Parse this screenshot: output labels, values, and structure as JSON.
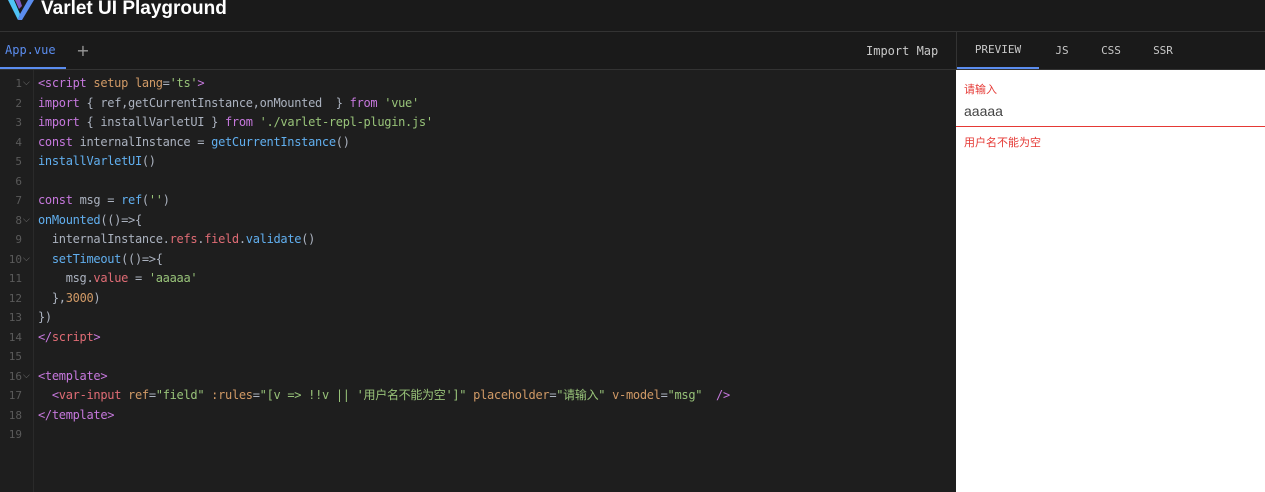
{
  "header": {
    "title": "Varlet UI Playground"
  },
  "editor_tabs": {
    "file": "App.vue",
    "add": "+",
    "import_map": "Import Map"
  },
  "output_tabs": [
    {
      "label": "PREVIEW",
      "active": true
    },
    {
      "label": "JS",
      "active": false
    },
    {
      "label": "CSS",
      "active": false
    },
    {
      "label": "SSR",
      "active": false
    }
  ],
  "line_numbers": [
    "1",
    "2",
    "3",
    "4",
    "5",
    "6",
    "7",
    "8",
    "9",
    "10",
    "11",
    "12",
    "13",
    "14",
    "15",
    "16",
    "17",
    "18",
    "19"
  ],
  "fold_lines": [
    1,
    8,
    10,
    16
  ],
  "code_lines": [
    [
      [
        "tag",
        "<script "
      ],
      [
        "attr",
        "setup "
      ],
      [
        "attr",
        "lang"
      ],
      [
        "punc",
        "="
      ],
      [
        "str",
        "'ts'"
      ],
      [
        "tag",
        ">"
      ]
    ],
    [
      [
        "kw",
        "import "
      ],
      [
        "punc",
        "{ "
      ],
      [
        "plain",
        "ref,getCurrentInstance,onMounted  "
      ],
      [
        "punc",
        "} "
      ],
      [
        "kw",
        "from "
      ],
      [
        "str",
        "'vue'"
      ]
    ],
    [
      [
        "kw",
        "import "
      ],
      [
        "punc",
        "{ "
      ],
      [
        "plain",
        "installVarletUI "
      ],
      [
        "punc",
        "} "
      ],
      [
        "kw",
        "from "
      ],
      [
        "str",
        "'./varlet-repl-plugin.js'"
      ]
    ],
    [
      [
        "kw",
        "const "
      ],
      [
        "plain",
        "internalInstance "
      ],
      [
        "punc",
        "= "
      ],
      [
        "fn",
        "getCurrentInstance"
      ],
      [
        "punc",
        "()"
      ]
    ],
    [
      [
        "fn",
        "installVarletUI"
      ],
      [
        "punc",
        "()"
      ]
    ],
    [],
    [
      [
        "kw",
        "const "
      ],
      [
        "plain",
        "msg "
      ],
      [
        "punc",
        "= "
      ],
      [
        "fn",
        "ref"
      ],
      [
        "punc",
        "("
      ],
      [
        "str",
        "''"
      ],
      [
        "punc",
        ")"
      ]
    ],
    [
      [
        "fn",
        "onMounted"
      ],
      [
        "punc",
        "(()=>{"
      ]
    ],
    [
      [
        "plain",
        "  "
      ],
      [
        "plain",
        "internalInstance"
      ],
      [
        "punc",
        "."
      ],
      [
        "var",
        "refs"
      ],
      [
        "punc",
        "."
      ],
      [
        "var",
        "field"
      ],
      [
        "punc",
        "."
      ],
      [
        "fn",
        "validate"
      ],
      [
        "punc",
        "()"
      ]
    ],
    [
      [
        "plain",
        "  "
      ],
      [
        "fn",
        "setTimeout"
      ],
      [
        "punc",
        "(()=>{"
      ]
    ],
    [
      [
        "plain",
        "    "
      ],
      [
        "plain",
        "msg"
      ],
      [
        "punc",
        "."
      ],
      [
        "var",
        "value"
      ],
      [
        "punc",
        " = "
      ],
      [
        "str",
        "'aaaaa'"
      ]
    ],
    [
      [
        "plain",
        "  "
      ],
      [
        "punc",
        "},"
      ],
      [
        "num",
        "3000"
      ],
      [
        "punc",
        ")"
      ]
    ],
    [
      [
        "punc",
        "})"
      ]
    ],
    [
      [
        "tag",
        "</"
      ],
      [
        "tagname",
        "script"
      ],
      [
        "tag",
        ">"
      ]
    ],
    [],
    [
      [
        "tag",
        "<template>"
      ]
    ],
    [
      [
        "plain",
        "  "
      ],
      [
        "tag",
        "<"
      ],
      [
        "tagname",
        "var-input "
      ],
      [
        "attr",
        "ref"
      ],
      [
        "punc",
        "="
      ],
      [
        "str",
        "\"field\" "
      ],
      [
        "attr",
        ":rules"
      ],
      [
        "punc",
        "="
      ],
      [
        "str",
        "\"[v => !!v || '用户名不能为空']\" "
      ],
      [
        "attr",
        "placeholder"
      ],
      [
        "punc",
        "="
      ],
      [
        "str",
        "\"请输入\" "
      ],
      [
        "attr",
        "v-model"
      ],
      [
        "punc",
        "="
      ],
      [
        "str",
        "\"msg\"  "
      ],
      [
        "tag",
        "/>"
      ]
    ],
    [
      [
        "tag",
        "</template>"
      ]
    ],
    []
  ],
  "preview": {
    "label": "请输入",
    "value": "aaaaa",
    "error": "用户名不能为空"
  },
  "colors": {
    "accent": "#5b8def",
    "error": "#e53935"
  }
}
